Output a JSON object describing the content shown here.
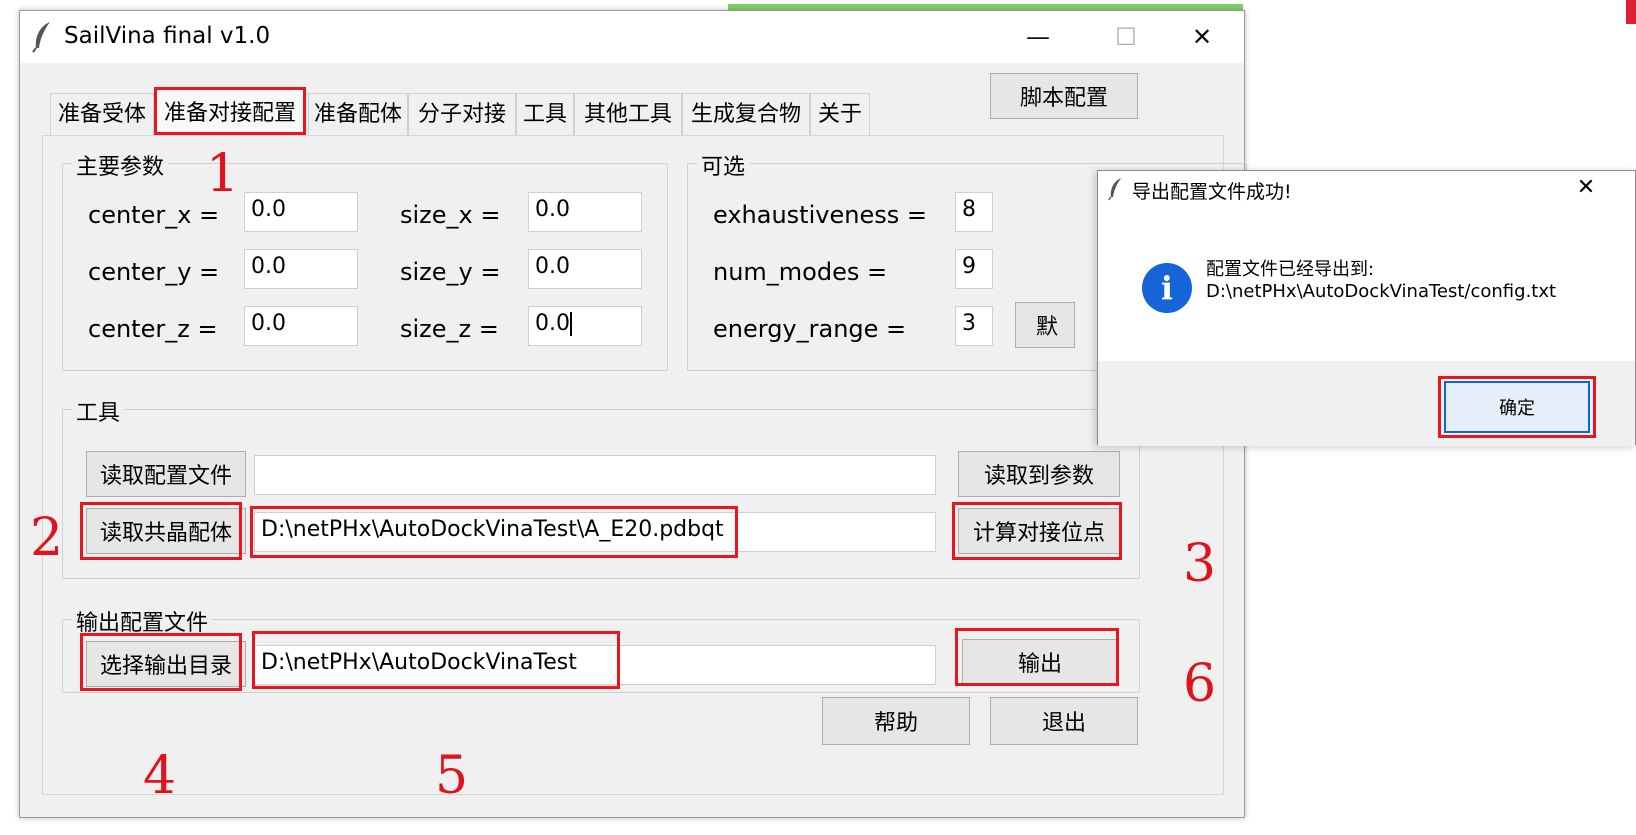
{
  "window": {
    "title": "SailVina final v1.0",
    "minimize": "—",
    "maximize": "☐",
    "close": "✕"
  },
  "tabs": [
    {
      "label": "准备受体"
    },
    {
      "label": "准备对接配置"
    },
    {
      "label": "准备配体"
    },
    {
      "label": "分子对接"
    },
    {
      "label": "工具"
    },
    {
      "label": "其他工具"
    },
    {
      "label": "生成复合物"
    },
    {
      "label": "关于"
    }
  ],
  "script_config_button": "脚本配置",
  "main_params": {
    "title": "主要参数",
    "center_x_label": "center_x =",
    "center_x": "0.0",
    "center_y_label": "center_y =",
    "center_y": "0.0",
    "center_z_label": "center_z =",
    "center_z": "0.0",
    "size_x_label": "size_x =",
    "size_x": "0.0",
    "size_y_label": "size_y =",
    "size_y": "0.0",
    "size_z_label": "size_z =",
    "size_z": "0.0"
  },
  "optional": {
    "title": "可选",
    "exhaustiveness_label": "exhaustiveness =",
    "exhaustiveness": "8",
    "num_modes_label": "num_modes =",
    "num_modes": "9",
    "energy_range_label": "energy_range =",
    "energy_range": "3",
    "partial_button": "默"
  },
  "tools": {
    "title": "工具",
    "read_config_button": "读取配置文件",
    "config_path": "",
    "read_to_params_button": "读取到参数",
    "read_ligand_button": "读取共晶配体",
    "ligand_path": "D:\\netPHx\\AutoDockVinaTest\\A_E20.pdbqt",
    "calc_site_button": "计算对接位点"
  },
  "output": {
    "title": "输出配置文件",
    "choose_dir_button": "选择输出目录",
    "dir_path": "D:\\netPHx\\AutoDockVinaTest",
    "output_button": "输出"
  },
  "help_button": "帮助",
  "exit_button": "退出",
  "markers": {
    "m1": "1",
    "m2": "2",
    "m3": "3",
    "m4": "4",
    "m5": "5",
    "m6": "6"
  },
  "dialog": {
    "title": "导出配置文件成功!",
    "close": "✕",
    "icon": "i",
    "message_line1": "配置文件已经导出到:",
    "message_line2": "D:\\netPHx\\AutoDockVinaTest/config.txt",
    "ok_button": "确定"
  },
  "colors": {
    "highlight": "#e8161f",
    "info_blue": "#1565d8",
    "window_bg": "#f0f0f0"
  }
}
